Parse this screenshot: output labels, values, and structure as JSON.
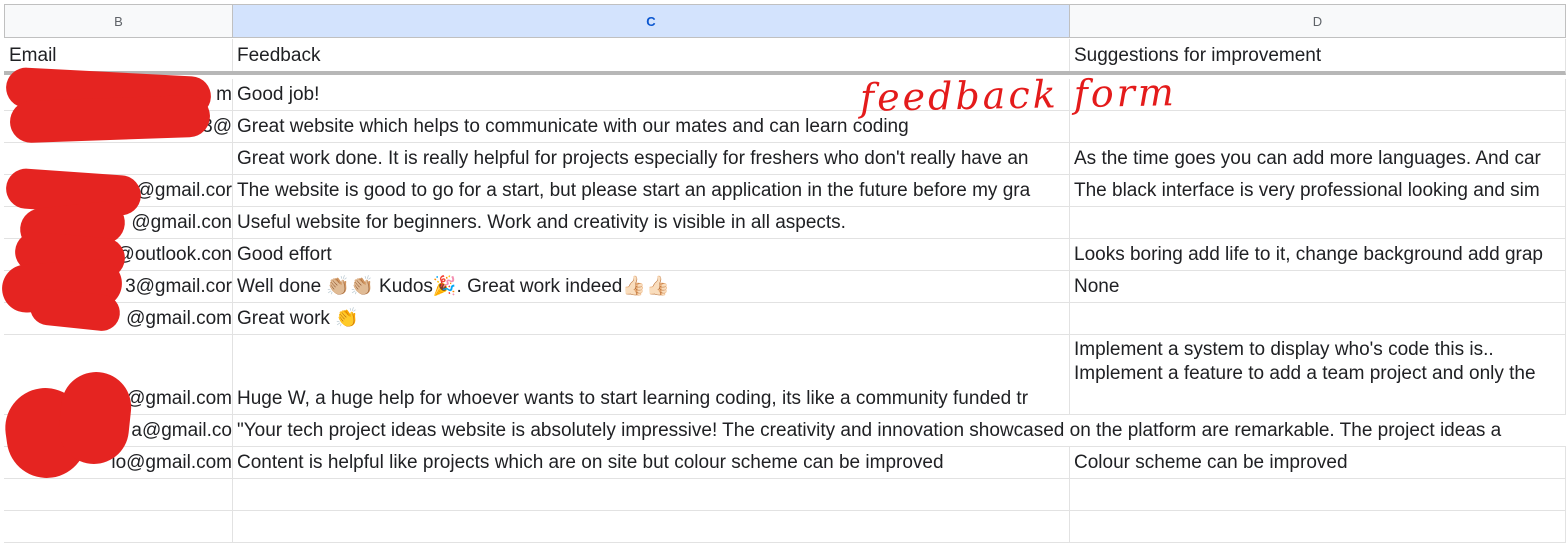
{
  "columns": {
    "b": "B",
    "c": "C",
    "d": "D"
  },
  "header": {
    "email": "Email",
    "feedback": "Feedback",
    "suggestions": "Suggestions for improvement"
  },
  "rows": [
    {
      "email": "m",
      "feedback": "Good job!",
      "suggestion": ""
    },
    {
      "email": "3@",
      "feedback": "Great website which helps to communicate with our mates and can learn coding",
      "suggestion": ""
    },
    {
      "email": "",
      "feedback": "Great work done. It is really helpful for projects especially for freshers who don't really have an",
      "suggestion": "As the time goes you can add more languages. And car"
    },
    {
      "email": "@gmail.cor",
      "feedback": "The website is good to go for a start, but please start an application in the future before my gra",
      "suggestion": "The black interface is very professional looking and sim"
    },
    {
      "email": "@gmail.con",
      "feedback": "Useful website for beginners. Work and creativity is visible in all aspects.",
      "suggestion": ""
    },
    {
      "email": "@outlook.con",
      "feedback": "Good effort",
      "suggestion": "Looks boring add life to it, change background add grap"
    },
    {
      "email": "3@gmail.cor",
      "feedback": "Well done 👏🏼👏🏼 Kudos🎉. Great work indeed👍🏻👍🏻",
      "suggestion": "None"
    },
    {
      "email": "@gmail.com",
      "feedback": "Great work 👏",
      "suggestion": ""
    },
    {
      "email": "@gmail.com",
      "feedback": "Huge W, a huge help for whoever wants to start learning coding, its like a community funded tr",
      "suggestion": "Implement a system to display who's code this is..\nImplement a feature to add a team project and only the"
    },
    {
      "email": "a@gmail.co",
      "feedback": "\"Your tech project ideas website is absolutely impressive! The creativity and innovation showcased on the platform are remarkable. The project ideas a",
      "suggestion": ""
    },
    {
      "email": "io@gmail.com",
      "feedback": "Content is helpful like projects which are on site but colour scheme can be improved",
      "suggestion": "Colour scheme can be improved"
    },
    {
      "email": "",
      "feedback": "",
      "suggestion": ""
    },
    {
      "email": "",
      "feedback": "",
      "suggestion": ""
    }
  ],
  "annotation": "feedback form",
  "colors": {
    "redaction": "#e52421",
    "selected_header_bg": "#d3e3fd",
    "annotation": "#e41b1b"
  }
}
